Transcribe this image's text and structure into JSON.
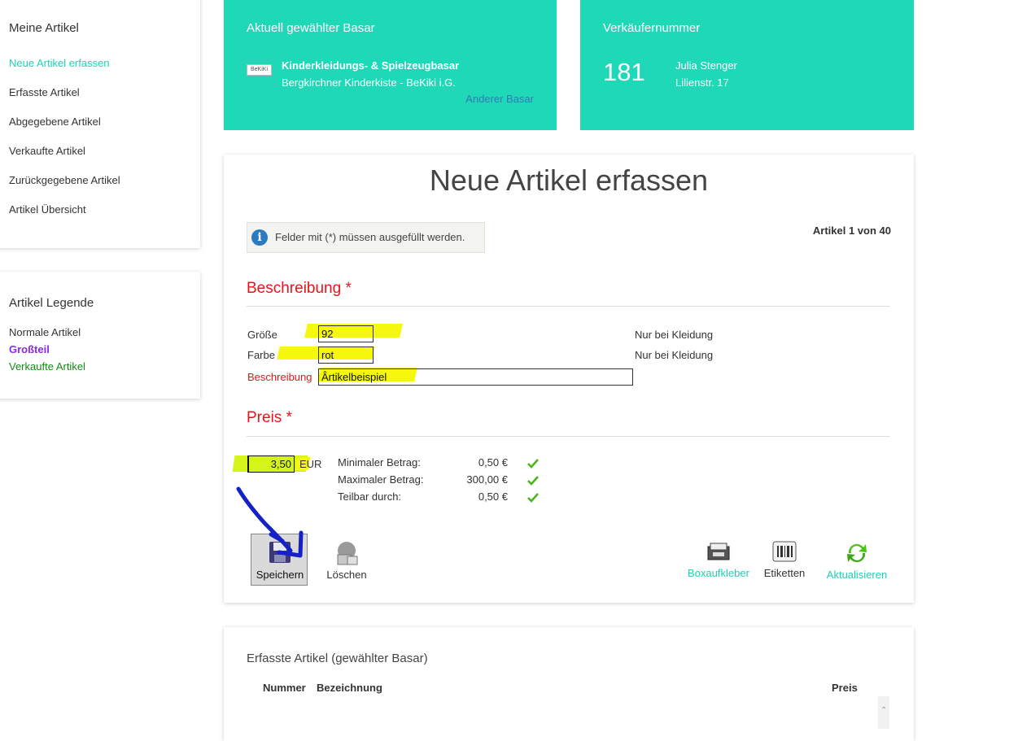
{
  "sidebar": {
    "title": "Meine Artikel",
    "items": [
      {
        "label": "Neue Artikel erfassen",
        "active": true
      },
      {
        "label": "Erfasste Artikel"
      },
      {
        "label": "Abgegebene Artikel"
      },
      {
        "label": "Verkaufte Artikel"
      },
      {
        "label": "Zurückgegebene Artikel"
      },
      {
        "label": "Artikel Übersicht"
      }
    ]
  },
  "legend": {
    "title": "Artikel Legende",
    "items": [
      {
        "label": "Normale Artikel",
        "color": "#333333"
      },
      {
        "label": "Großteil",
        "color": "#8a2be2"
      },
      {
        "label": "Verkaufte Artikel",
        "color": "#138a13"
      }
    ]
  },
  "bazaar_card": {
    "header": "Aktuell gewählter Basar",
    "logo_text": "BeKiKi",
    "name": "Kinderkleidungs- & Spielzeugbasar",
    "organizer": "Bergkirchner Kinderkiste - BeKiki i.G.",
    "change_link": "Anderer Basar"
  },
  "seller_card": {
    "header": "Verkäufernummer",
    "number": "181",
    "name": "Julia Stenger",
    "street": "Lilienstr. 17"
  },
  "main": {
    "title": "Neue Artikel erfassen",
    "info": "Felder mit (*) müssen ausgefüllt werden.",
    "article_count": "Artikel 1 von 40",
    "description_section": "Beschreibung *",
    "fields": {
      "size_label": "Größe",
      "size_value": "92",
      "size_hint": "Nur bei Kleidung",
      "color_label": "Farbe",
      "color_value": "rot",
      "color_hint": "Nur bei Kleidung",
      "desc_label": "Beschreibung",
      "desc_value": "Ârtikelbeispiel"
    },
    "price_section": "Preis *",
    "price": {
      "value": "3,50",
      "currency": "EUR",
      "min_label": "Minimaler Betrag:",
      "min_value": "0,50 €",
      "max_label": "Maximaler Betrag:",
      "max_value": "300,00 €",
      "div_label": "Teilbar durch:",
      "div_value": "0,50 €"
    },
    "actions": {
      "save": "Speichern",
      "delete": "Löschen",
      "box_label": "Boxaufkleber",
      "labels": "Etiketten",
      "refresh": "Aktualisieren"
    }
  },
  "list": {
    "title": "Erfasste Artikel (gewählter Basar)",
    "columns": [
      "Nummer",
      "Bezeichnung",
      "Preis"
    ]
  },
  "colors": {
    "teal": "#1fd8b8",
    "accent_link": "#1fd0b3",
    "required_red": "#e8141a",
    "highlight_yellow": "#f5f80c",
    "annotation_blue": "#1420c8"
  }
}
